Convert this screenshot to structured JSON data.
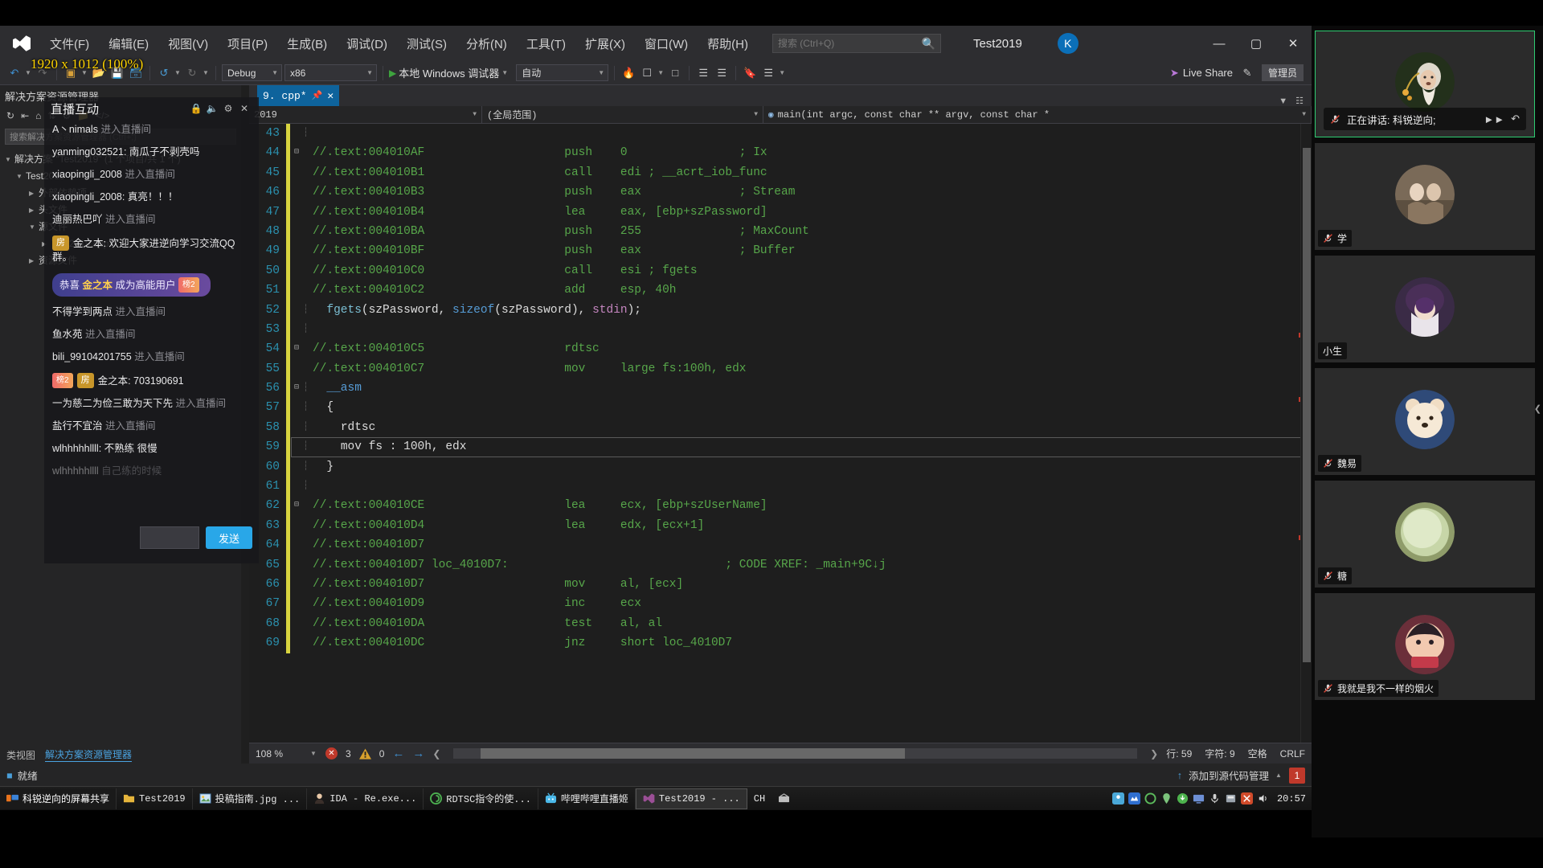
{
  "overlay": {
    "resolution_badge": "1920 x 1012 (100%)"
  },
  "vs": {
    "menu": [
      "文件(F)",
      "编辑(E)",
      "视图(V)",
      "项目(P)",
      "生成(B)",
      "调试(D)",
      "测试(S)",
      "分析(N)",
      "工具(T)",
      "扩展(X)",
      "窗口(W)",
      "帮助(H)"
    ],
    "search_placeholder": "搜索 (Ctrl+Q)",
    "project_name": "Test2019",
    "account_initial": "K",
    "minimize": "—",
    "maximize": "▢",
    "close": "✕",
    "toolbar": {
      "config": "Debug",
      "platform": "x86",
      "run_label": "本地 Windows 调试器",
      "auto": "自动",
      "live_share": "Live Share",
      "admin": "管理员"
    },
    "solution_explorer": {
      "title": "解决方案资源管理器",
      "search_placeholder": "搜索解决方案资源管理器 (Ctrl+;)",
      "root": "解决方案 \"Test2019\" (1 个项目/共 1 个)",
      "project": "Test2019",
      "nodes": [
        "外部依赖项",
        "头文件",
        "源文件",
        "Test2019.cpp",
        "资源文件"
      ],
      "tabs": [
        "类视图",
        "解决方案资源管理器"
      ]
    }
  },
  "chat": {
    "title": "直播互动",
    "icons": [
      "lock-icon",
      "mute-icon",
      "settings-icon",
      "close-icon"
    ],
    "messages": [
      {
        "type": "join",
        "user": "A丶nimals",
        "action": "进入直播间"
      },
      {
        "type": "say",
        "user": "yanming032521",
        "text": "南瓜子不剥壳吗"
      },
      {
        "type": "join",
        "user": "xiaopingli_2008",
        "action": "进入直播间"
      },
      {
        "type": "say",
        "user": "xiaopingli_2008",
        "text": "真亮！！！"
      },
      {
        "type": "join",
        "user": "迪丽热巴吖",
        "action": "进入直播间"
      },
      {
        "type": "say",
        "user": "金之本",
        "text": "欢迎大家进逆向学习交流QQ群。",
        "badges": [
          "房"
        ]
      },
      {
        "type": "honor",
        "prefix": "恭喜",
        "name": "金之本",
        "suffix": "成为高能用户",
        "level": "2"
      },
      {
        "type": "join",
        "user": "不得学到两点",
        "action": "进入直播间"
      },
      {
        "type": "join",
        "user": "鱼水苑",
        "action": "进入直播间"
      },
      {
        "type": "join",
        "user": "bili_99104201755",
        "action": "进入直播间"
      },
      {
        "type": "say",
        "user": "金之本",
        "text": "703190691",
        "badges": [
          "lv2",
          "房"
        ]
      },
      {
        "type": "join",
        "user": "一为慈二为俭三敢为天下先",
        "action": "进入直播间"
      },
      {
        "type": "join",
        "user": "盐行不宜治",
        "action": "进入直播间"
      },
      {
        "type": "say",
        "user": "wlhhhhhllll",
        "text": "不熟练 很慢"
      },
      {
        "type": "join",
        "user": "wlhhhhhllll",
        "action": "自己练的时候"
      }
    ],
    "send_label": "发送"
  },
  "editor": {
    "tab_label": "9. cpp*",
    "nav": {
      "project": "2019",
      "scope": "(全局范围)",
      "member": "main(int argc, const char ** argv, const char *"
    },
    "lines": [
      {
        "n": 43,
        "fold": "",
        "text": "",
        "kind": "blank"
      },
      {
        "n": 44,
        "fold": "-",
        "text": "//.text:004010AF                    push    0                ; Ix",
        "kind": "comment"
      },
      {
        "n": 45,
        "fold": "",
        "text": "//.text:004010B1                    call    edi ; __acrt_iob_func",
        "kind": "comment"
      },
      {
        "n": 46,
        "fold": "",
        "text": "//.text:004010B3                    push    eax              ; Stream",
        "kind": "comment"
      },
      {
        "n": 47,
        "fold": "",
        "text": "//.text:004010B4                    lea     eax, [ebp+szPassword]",
        "kind": "comment"
      },
      {
        "n": 48,
        "fold": "",
        "text": "//.text:004010BA                    push    255              ; MaxCount",
        "kind": "comment"
      },
      {
        "n": 49,
        "fold": "",
        "text": "//.text:004010BF                    push    eax              ; Buffer",
        "kind": "comment"
      },
      {
        "n": 50,
        "fold": "",
        "text": "//.text:004010C0                    call    esi ; fgets",
        "kind": "comment"
      },
      {
        "n": 51,
        "fold": "",
        "text": "//.text:004010C2                    add     esp, 40h",
        "kind": "comment"
      },
      {
        "n": 52,
        "fold": "",
        "text": "fgets(szPassword, sizeof(szPassword), stdin);",
        "kind": "code-fgets"
      },
      {
        "n": 53,
        "fold": "",
        "text": "",
        "kind": "blank"
      },
      {
        "n": 54,
        "fold": "-",
        "text": "//.text:004010C5                    rdtsc",
        "kind": "comment"
      },
      {
        "n": 55,
        "fold": "",
        "text": "//.text:004010C7                    mov     large fs:100h, edx",
        "kind": "comment"
      },
      {
        "n": 56,
        "fold": "-",
        "text": "__asm",
        "kind": "code-asm"
      },
      {
        "n": 57,
        "fold": "",
        "text": "{",
        "kind": "code-plain"
      },
      {
        "n": 58,
        "fold": "",
        "text": "rdtsc",
        "kind": "code-plain"
      },
      {
        "n": 59,
        "fold": "",
        "text": "mov fs : 100h, edx",
        "kind": "code-plain"
      },
      {
        "n": 60,
        "fold": "",
        "text": "}",
        "kind": "code-plain"
      },
      {
        "n": 61,
        "fold": "",
        "text": "",
        "kind": "blank"
      },
      {
        "n": 62,
        "fold": "-",
        "text": "//.text:004010CE                    lea     ecx, [ebp+szUserName]",
        "kind": "comment"
      },
      {
        "n": 63,
        "fold": "",
        "text": "//.text:004010D4                    lea     edx, [ecx+1]",
        "kind": "comment"
      },
      {
        "n": 64,
        "fold": "",
        "text": "//.text:004010D7",
        "kind": "comment"
      },
      {
        "n": 65,
        "fold": "",
        "text": "//.text:004010D7 loc_4010D7:                               ; CODE XREF: _main+9C↓j",
        "kind": "comment"
      },
      {
        "n": 66,
        "fold": "",
        "text": "//.text:004010D7                    mov     al, [ecx]",
        "kind": "comment"
      },
      {
        "n": 67,
        "fold": "",
        "text": "//.text:004010D9                    inc     ecx",
        "kind": "comment"
      },
      {
        "n": 68,
        "fold": "",
        "text": "//.text:004010DA                    test    al, al",
        "kind": "comment"
      },
      {
        "n": 69,
        "fold": "",
        "text": "//.text:004010DC                    jnz     short loc_4010D7",
        "kind": "comment"
      }
    ],
    "current_line": 59,
    "status": {
      "zoom": "108 %",
      "errors": "3",
      "warnings": "0",
      "line_label": "行:",
      "line_value": "59",
      "col_label": "字符:",
      "col_value": "9",
      "spaces": "空格",
      "eol": "CRLF"
    }
  },
  "vs_bottom": {
    "item_label": "就绪",
    "add_to_source_control": "添加到源代码管理",
    "notification_count": "1"
  },
  "video": {
    "tiles": [
      {
        "name": "科锐逆向;",
        "speaking_prefix": "正在讲话:",
        "active": true,
        "muted": true,
        "avatar": "elder-avatar"
      },
      {
        "name": "学",
        "active": false,
        "muted": true,
        "avatar": "couple-avatar"
      },
      {
        "name": "小生",
        "active": false,
        "muted": false,
        "avatar": "purple-avatar"
      },
      {
        "name": "魏易",
        "active": false,
        "muted": true,
        "avatar": "bear-avatar"
      },
      {
        "name": "糖",
        "active": false,
        "muted": true,
        "avatar": "green-avatar"
      },
      {
        "name": "我就是我不一样的烟火",
        "active": false,
        "muted": true,
        "avatar": "anime-avatar"
      }
    ]
  },
  "taskbar": {
    "items": [
      {
        "label": "科锐逆向的屏幕共享",
        "icon": "share-icon",
        "first": true
      },
      {
        "label": "Test2019",
        "icon": "folder-icon"
      },
      {
        "label": "投稿指南.jpg ...",
        "icon": "image-icon"
      },
      {
        "label": "IDA - Re.exe...",
        "icon": "ida-icon"
      },
      {
        "label": "RDTSC指令的使...",
        "icon": "browser-icon"
      },
      {
        "label": "哔哩哔哩直播姬",
        "icon": "bili-icon"
      },
      {
        "label": "Test2019 - ...",
        "icon": "vs-icon",
        "active": true
      }
    ],
    "ime": "CH",
    "clock": "20:57"
  }
}
